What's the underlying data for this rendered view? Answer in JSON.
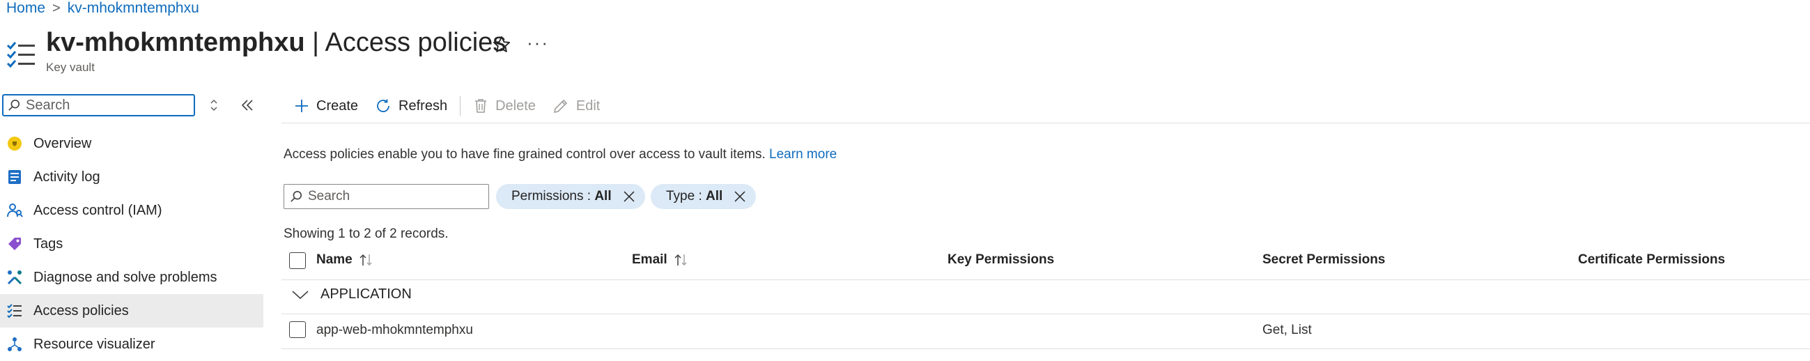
{
  "breadcrumb": {
    "home": "Home",
    "separator": ">",
    "current": "kv-mhokmntemphxu"
  },
  "header": {
    "resource_name": "kv-mhokmntemphxu",
    "title_separator": " | ",
    "page_title": "Access policies",
    "resource_type": "Key vault",
    "more_label": "···"
  },
  "sidebar": {
    "search_placeholder": "Search",
    "items": [
      {
        "label": "Overview",
        "icon": "overview-icon"
      },
      {
        "label": "Activity log",
        "icon": "activity-log-icon"
      },
      {
        "label": "Access control (IAM)",
        "icon": "iam-icon"
      },
      {
        "label": "Tags",
        "icon": "tag-icon"
      },
      {
        "label": "Diagnose and solve problems",
        "icon": "wrench-icon"
      },
      {
        "label": "Access policies",
        "icon": "access-policies-icon",
        "active": true
      },
      {
        "label": "Resource visualizer",
        "icon": "resource-visualizer-icon"
      }
    ]
  },
  "toolbar": {
    "create": "Create",
    "refresh": "Refresh",
    "delete": "Delete",
    "edit": "Edit"
  },
  "description": {
    "text": "Access policies enable you to have fine grained control over access to vault items. ",
    "link": "Learn more"
  },
  "filters": {
    "search_placeholder": "Search",
    "permissions": {
      "label": "Permissions : ",
      "value": "All"
    },
    "type": {
      "label": "Type : ",
      "value": "All"
    }
  },
  "records_text": "Showing 1 to 2 of 2 records.",
  "table": {
    "columns": [
      "Name",
      "Email",
      "Key Permissions",
      "Secret Permissions",
      "Certificate Permissions"
    ],
    "groups": [
      {
        "label": "APPLICATION",
        "rows": [
          {
            "name": "app-web-mhokmntemphxu",
            "email": "",
            "key_permissions": "",
            "secret_permissions": "Get, List",
            "certificate_permissions": ""
          }
        ]
      }
    ]
  },
  "colors": {
    "accent": "#0f6cbd",
    "pill_bg": "#dce9f6",
    "active_nav_bg": "#ebebeb"
  }
}
